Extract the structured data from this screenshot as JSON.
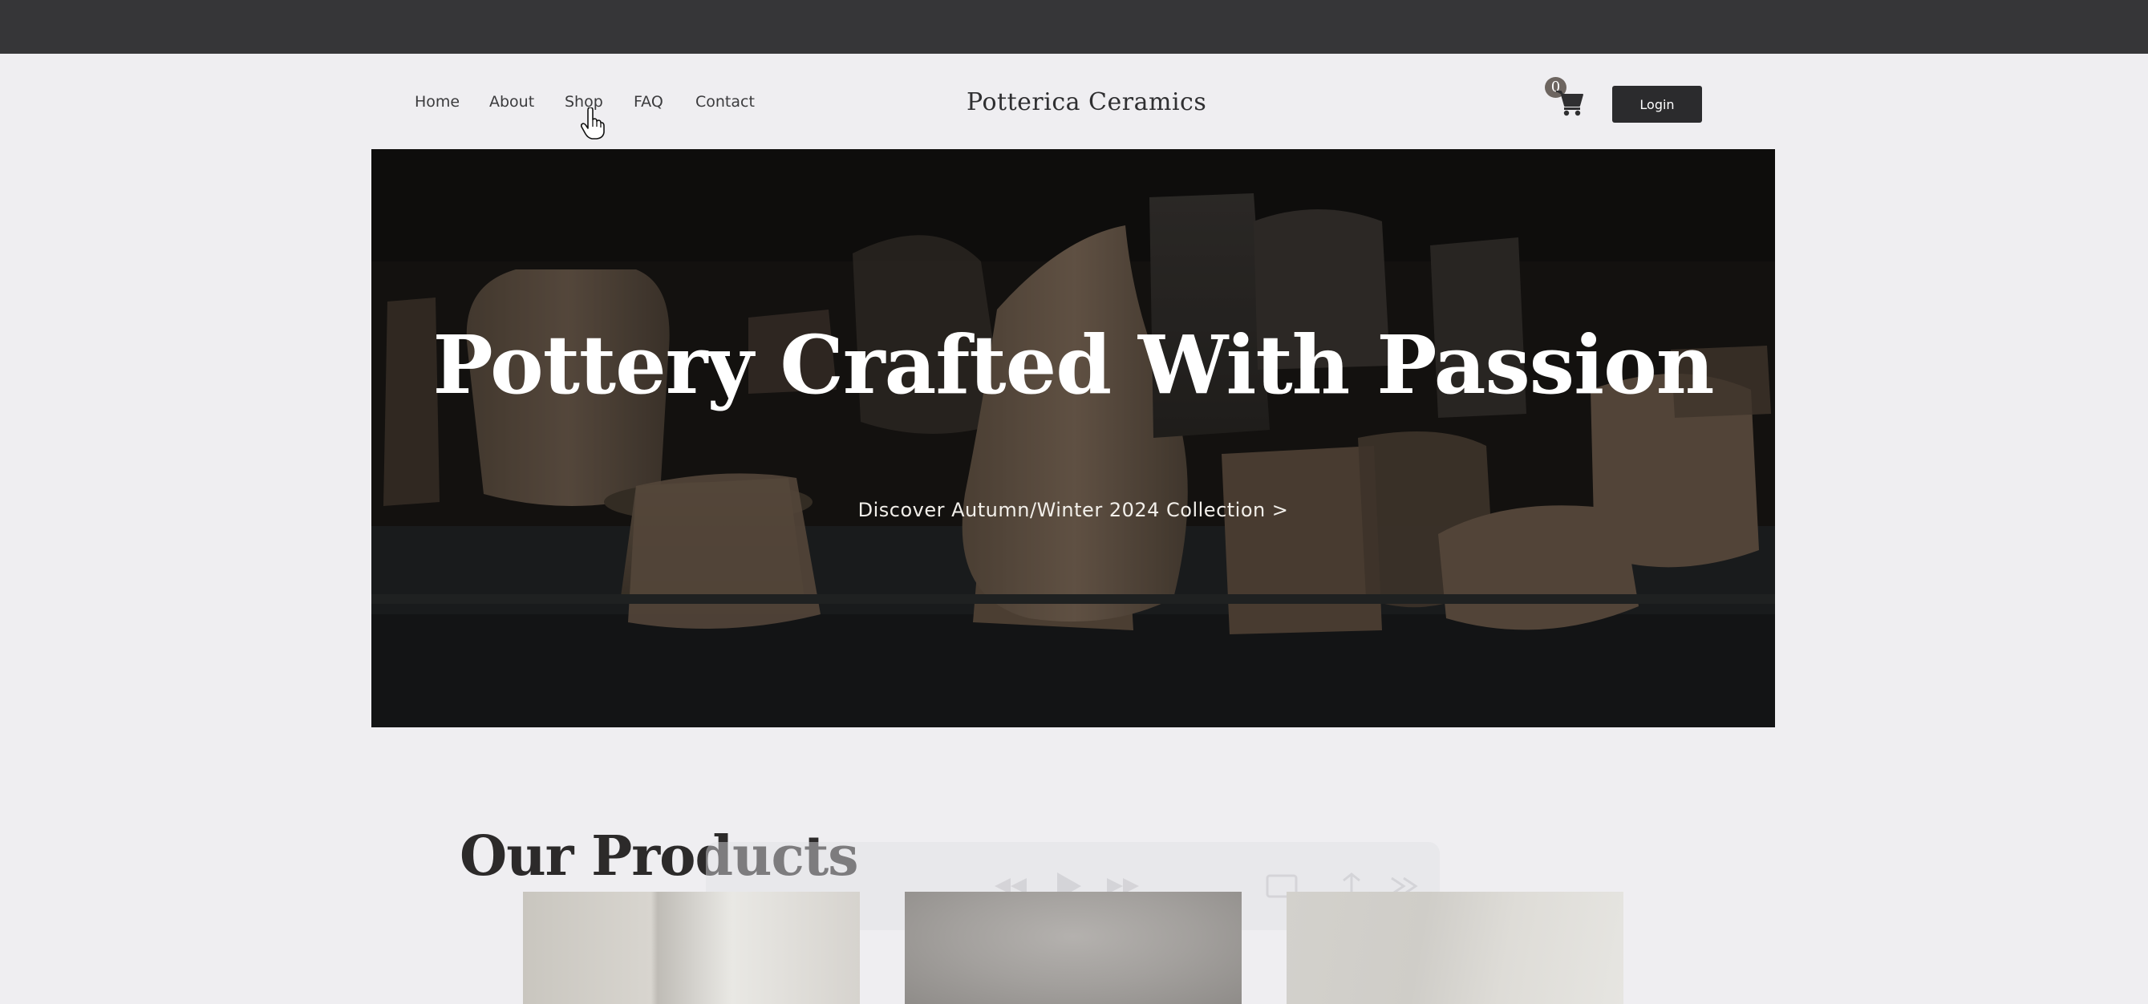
{
  "nav": {
    "items": [
      {
        "label": "Home"
      },
      {
        "label": "About"
      },
      {
        "label": "Shop"
      },
      {
        "label": "FAQ"
      },
      {
        "label": "Contact"
      }
    ]
  },
  "brand": {
    "name": "Potterica Ceramics"
  },
  "cart": {
    "count": "0",
    "icon": "shopping-cart-icon"
  },
  "login": {
    "label": "Login"
  },
  "hero": {
    "title": "Pottery Crafted With Passion",
    "link_text": "Discover Autumn/Winter 2024 Collection",
    "link_arrow": ">"
  },
  "products": {
    "title": "Our Products"
  },
  "colors": {
    "top_bar": "#363638",
    "background": "#efeef1",
    "button": "#2b2b2d",
    "badge": "#6d6560"
  }
}
